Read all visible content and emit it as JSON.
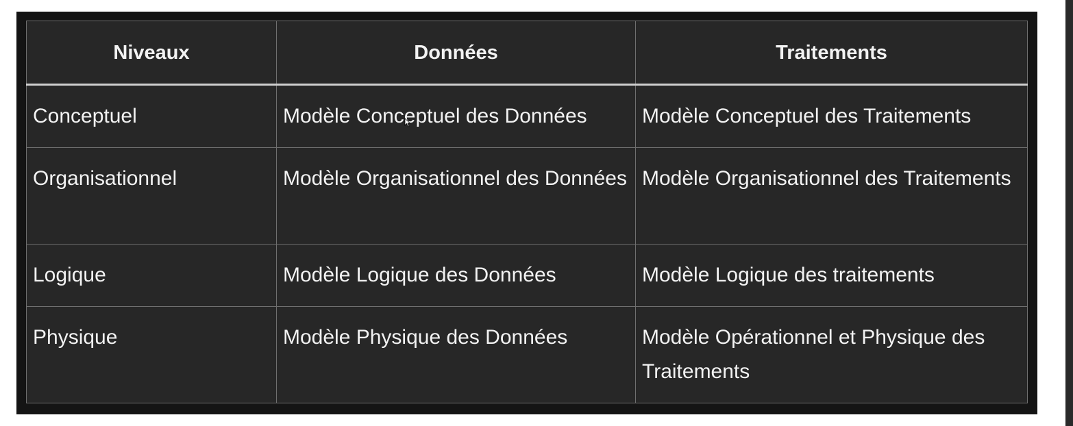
{
  "table": {
    "headers": [
      "Niveaux",
      "Données",
      "Traitements"
    ],
    "rows": [
      [
        "Conceptuel",
        "Modèle Conceptuel des Données",
        "Modèle Conceptuel des Traitements"
      ],
      [
        "Organisationnel",
        "Modèle Organisationnel des Données",
        "Modèle Organisationnel des Traitements"
      ],
      [
        "Logique",
        "Modèle Logique des Données",
        "Modèle Logique des traitements"
      ],
      [
        "Physique",
        "Modèle Physique des Données",
        "Modèle Opérationnel et Physique des Traitements"
      ]
    ]
  },
  "colors": {
    "frame_background": "#141414",
    "table_background": "#272727",
    "text": "#f2f2f2",
    "border": "#6f6f6f",
    "header_separator": "#cfcfcf"
  },
  "icons": {
    "cursor": "mouse-pointer-icon"
  }
}
